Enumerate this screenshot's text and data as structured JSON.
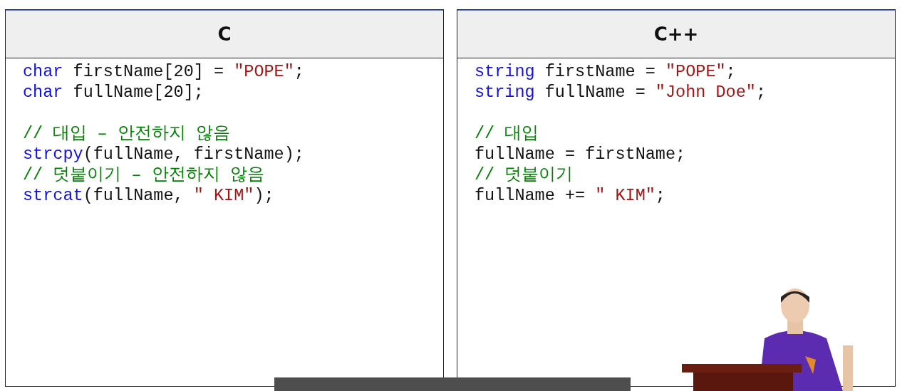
{
  "panels": [
    {
      "title": "C",
      "blocks": [
        [
          {
            "tokens": [
              {
                "kind": "keyword",
                "text": "char"
              },
              {
                "kind": "plain",
                "text": " firstName[20] = "
              },
              {
                "kind": "string",
                "text": "\"POPE\""
              },
              {
                "kind": "plain",
                "text": ";"
              }
            ]
          },
          {
            "tokens": [
              {
                "kind": "keyword",
                "text": "char"
              },
              {
                "kind": "plain",
                "text": " fullName[20];"
              }
            ]
          }
        ],
        [
          {
            "tokens": [
              {
                "kind": "comment",
                "text": "// 대입 – 안전하지 않음"
              }
            ]
          },
          {
            "tokens": [
              {
                "kind": "keyword",
                "text": "strcpy"
              },
              {
                "kind": "plain",
                "text": "(fullName, firstName);"
              }
            ]
          },
          {
            "tokens": [
              {
                "kind": "comment",
                "text": "// 덧붙이기 – 안전하지 않음"
              }
            ]
          },
          {
            "tokens": [
              {
                "kind": "keyword",
                "text": "strcat"
              },
              {
                "kind": "plain",
                "text": "(fullName, "
              },
              {
                "kind": "string",
                "text": "\" KIM\""
              },
              {
                "kind": "plain",
                "text": ");"
              }
            ]
          }
        ]
      ]
    },
    {
      "title": "C++",
      "blocks": [
        [
          {
            "tokens": [
              {
                "kind": "keyword",
                "text": "string"
              },
              {
                "kind": "plain",
                "text": " firstName = "
              },
              {
                "kind": "string",
                "text": "\"POPE\""
              },
              {
                "kind": "plain",
                "text": ";"
              }
            ]
          },
          {
            "tokens": [
              {
                "kind": "keyword",
                "text": "string"
              },
              {
                "kind": "plain",
                "text": " fullName = "
              },
              {
                "kind": "string",
                "text": "\"John Doe\""
              },
              {
                "kind": "plain",
                "text": ";"
              }
            ]
          }
        ],
        [
          {
            "tokens": [
              {
                "kind": "comment",
                "text": "// 대입"
              }
            ]
          },
          {
            "tokens": [
              {
                "kind": "plain",
                "text": "fullName = firstName;"
              }
            ]
          },
          {
            "tokens": [
              {
                "kind": "comment",
                "text": "// 덧붙이기"
              }
            ]
          },
          {
            "tokens": [
              {
                "kind": "plain",
                "text": "fullName += "
              },
              {
                "kind": "string",
                "text": "\" KIM\""
              },
              {
                "kind": "plain",
                "text": ";"
              }
            ]
          }
        ]
      ]
    }
  ],
  "caption_bar": {
    "visible": true
  }
}
